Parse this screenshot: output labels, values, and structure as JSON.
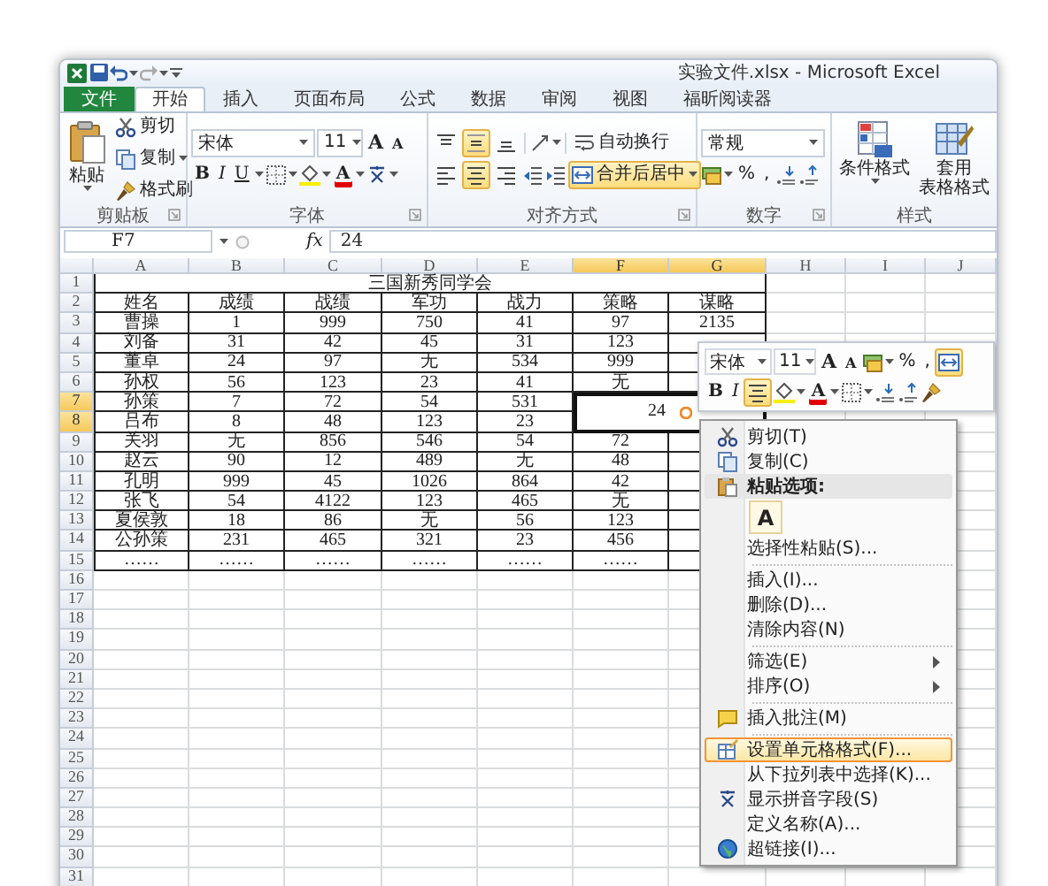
{
  "window": {
    "title": "实验文件.xlsx - Microsoft Excel"
  },
  "tabs": [
    {
      "label": "文件",
      "kind": "file",
      "selected": false
    },
    {
      "label": "开始",
      "kind": "tab",
      "selected": true
    },
    {
      "label": "插入",
      "kind": "tab",
      "selected": false
    },
    {
      "label": "页面布局",
      "kind": "tab",
      "selected": false
    },
    {
      "label": "公式",
      "kind": "tab",
      "selected": false
    },
    {
      "label": "数据",
      "kind": "tab",
      "selected": false
    },
    {
      "label": "审阅",
      "kind": "tab",
      "selected": false
    },
    {
      "label": "视图",
      "kind": "tab",
      "selected": false
    },
    {
      "label": "福昕阅读器",
      "kind": "tab",
      "selected": false
    }
  ],
  "ribbon": {
    "clipboard": {
      "label": "剪贴板",
      "paste": "粘贴",
      "cut": "剪切",
      "copy": "复制",
      "format_painter": "格式刷"
    },
    "font": {
      "label": "字体",
      "font_name": "宋体",
      "font_size": "11",
      "grow": "A",
      "shrink": "A",
      "bold": "B",
      "italic": "I",
      "underline": "U",
      "font_color": "A"
    },
    "alignment": {
      "label": "对齐方式",
      "wrap_text": "自动换行",
      "vertical": [
        {
          "selected": false
        },
        {
          "selected": true
        },
        {
          "selected": false
        }
      ],
      "horizontal": [
        {
          "selected": false
        },
        {
          "selected": true
        },
        {
          "selected": false
        }
      ],
      "merge_center": {
        "label": "合并后居中",
        "selected": true
      }
    },
    "number": {
      "label": "数字",
      "format": "常规",
      "percent": "%",
      "comma": ","
    },
    "styles": {
      "label": "样式",
      "conditional_format": "条件格式",
      "table_format": [
        "套用",
        "表格格式"
      ]
    }
  },
  "formula_bar": {
    "name_box": "F7",
    "fx": "fx",
    "value": "24"
  },
  "sheet": {
    "columns": [
      {
        "label": "A",
        "selected": false
      },
      {
        "label": "B",
        "selected": false
      },
      {
        "label": "C",
        "selected": false
      },
      {
        "label": "D",
        "selected": false
      },
      {
        "label": "E",
        "selected": false
      },
      {
        "label": "F",
        "selected": true
      },
      {
        "label": "G",
        "selected": true
      },
      {
        "label": "H",
        "selected": false
      },
      {
        "label": "I",
        "selected": false
      },
      {
        "label": "J",
        "selected": false
      }
    ],
    "rows": [
      {
        "header": "1",
        "kind": "title",
        "selected": false,
        "title": "三国新秀同学会"
      },
      {
        "header": "2",
        "kind": "table",
        "selected": false,
        "cells": [
          "姓名",
          "成绩",
          "战绩",
          "军功",
          "战力",
          "策略",
          "谋略"
        ]
      },
      {
        "header": "3",
        "kind": "table",
        "selected": false,
        "cells": [
          "曹操",
          "1",
          "999",
          "750",
          "41",
          "97",
          "2135"
        ]
      },
      {
        "header": "4",
        "kind": "table",
        "selected": false,
        "cells": [
          "刘备",
          "31",
          "42",
          "45",
          "31",
          "123"
        ]
      },
      {
        "header": "5",
        "kind": "table",
        "selected": false,
        "cells": [
          "董卓",
          "24",
          "97",
          "无",
          "534",
          "999"
        ]
      },
      {
        "header": "6",
        "kind": "table",
        "selected": false,
        "cells": [
          "孙权",
          "56",
          "123",
          "23",
          "41",
          "无"
        ]
      },
      {
        "header": "7",
        "kind": "table",
        "selected": true,
        "cells": [
          "孙策",
          "7",
          "72",
          "54",
          "531"
        ],
        "merged": {
          "value": "24",
          "selected": true
        }
      },
      {
        "header": "8",
        "kind": "table",
        "selected": true,
        "cells": [
          "吕布",
          "8",
          "48",
          "123",
          "23"
        ]
      },
      {
        "header": "9",
        "kind": "table",
        "selected": false,
        "cells": [
          "关羽",
          "无",
          "856",
          "546",
          "54",
          "72"
        ]
      },
      {
        "header": "10",
        "kind": "table",
        "selected": false,
        "cells": [
          "赵云",
          "90",
          "12",
          "489",
          "无",
          "48"
        ]
      },
      {
        "header": "11",
        "kind": "table",
        "selected": false,
        "cells": [
          "孔明",
          "999",
          "45",
          "1026",
          "864",
          "42"
        ]
      },
      {
        "header": "12",
        "kind": "table",
        "selected": false,
        "cells": [
          "张飞",
          "54",
          "4122",
          "123",
          "465",
          "无"
        ]
      },
      {
        "header": "13",
        "kind": "table",
        "selected": false,
        "cells": [
          "夏侯敦",
          "18",
          "86",
          "无",
          "56",
          "123"
        ]
      },
      {
        "header": "14",
        "kind": "table",
        "selected": false,
        "cells": [
          "公孙策",
          "231",
          "465",
          "321",
          "23",
          "456"
        ]
      },
      {
        "header": "15",
        "kind": "table",
        "selected": false,
        "cells": [
          "……",
          "……",
          "……",
          "……",
          "……",
          "……"
        ]
      },
      {
        "header": "16",
        "kind": "blank",
        "selected": false
      },
      {
        "header": "17",
        "kind": "blank",
        "selected": false
      },
      {
        "header": "18",
        "kind": "blank",
        "selected": false
      },
      {
        "header": "19",
        "kind": "blank",
        "selected": false
      },
      {
        "header": "20",
        "kind": "blank",
        "selected": false
      },
      {
        "header": "21",
        "kind": "blank",
        "selected": false
      },
      {
        "header": "22",
        "kind": "blank",
        "selected": false
      },
      {
        "header": "23",
        "kind": "blank",
        "selected": false
      },
      {
        "header": "24",
        "kind": "blank",
        "selected": false
      },
      {
        "header": "25",
        "kind": "blank",
        "selected": false
      },
      {
        "header": "26",
        "kind": "blank",
        "selected": false
      },
      {
        "header": "27",
        "kind": "blank",
        "selected": false
      },
      {
        "header": "28",
        "kind": "blank",
        "selected": false
      },
      {
        "header": "29",
        "kind": "blank",
        "selected": false
      },
      {
        "header": "30",
        "kind": "blank",
        "selected": false
      },
      {
        "header": "31",
        "kind": "blank",
        "selected": false
      }
    ]
  },
  "mini_toolbar": {
    "font_name": "宋体",
    "font_size": "11",
    "grow": "A",
    "shrink": "A",
    "percent": "%",
    "comma": ",",
    "merge_selected": true,
    "bold": "B",
    "italic": "I",
    "center_selected": true,
    "font_color": "A"
  },
  "context_menu": {
    "sections": [
      {
        "items": [
          {
            "kind": "cut",
            "label": "剪切(T)",
            "selected": false
          },
          {
            "kind": "copy",
            "label": "复制(C)",
            "selected": false
          },
          {
            "kind": "paste_header",
            "label": "粘贴选项:",
            "selected": false
          },
          {
            "kind": "paste_option",
            "label": "A",
            "selected": false
          },
          {
            "kind": "plain",
            "label": "选择性粘贴(S)...",
            "selected": false
          }
        ]
      },
      {
        "items": [
          {
            "kind": "plain",
            "label": "插入(I)...",
            "selected": false
          },
          {
            "kind": "plain",
            "label": "删除(D)...",
            "selected": false
          },
          {
            "kind": "plain",
            "label": "清除内容(N)",
            "selected": false
          }
        ]
      },
      {
        "items": [
          {
            "kind": "submenu",
            "label": "筛选(E)",
            "selected": false
          },
          {
            "kind": "submenu",
            "label": "排序(O)",
            "selected": false
          }
        ]
      },
      {
        "items": [
          {
            "kind": "comment",
            "label": "插入批注(M)",
            "selected": false
          }
        ]
      },
      {
        "items": [
          {
            "kind": "format_cells",
            "label": "设置单元格格式(F)...",
            "selected": true
          },
          {
            "kind": "plain",
            "label": "从下拉列表中选择(K)...",
            "selected": false
          },
          {
            "kind": "phonetic",
            "label": "显示拼音字段(S)",
            "selected": false
          },
          {
            "kind": "plain",
            "label": "定义名称(A)...",
            "selected": false
          },
          {
            "kind": "hyperlink",
            "label": "超链接(I)...",
            "selected": false
          }
        ]
      }
    ]
  }
}
